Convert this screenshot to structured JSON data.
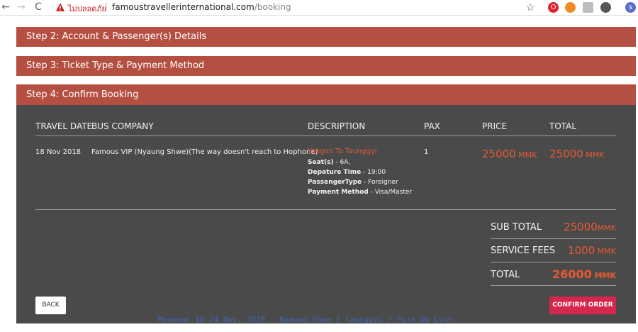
{
  "browser": {
    "back_icon": "←",
    "forward_icon": "→",
    "reload_icon": "C",
    "security_warning": "ไม่ปลอดภัย",
    "url_host": "famoustravellerinternational.com",
    "url_path": "/booking",
    "star_icon": "☆",
    "profile_initial": "s"
  },
  "steps": {
    "step2": "Step 2: Account & Passenger(s) Details",
    "step3": "Step 3: Ticket Type & Payment Method",
    "step4": "Step 4: Confirm Booking"
  },
  "table": {
    "headers": {
      "travel_date": "TRAVEL DATE",
      "bus_company": "BUS COMPANY",
      "description": "DESCRIPTION",
      "pax": "PAX",
      "price": "PRICE",
      "total": "TOTAL"
    },
    "row": {
      "travel_date": "18 Nov 2018",
      "bus_company": "Famous VIP (Nyaung Shwe)(The way doesn't reach to Hophone)",
      "route": "Yangon To Taunggyi",
      "seat_label": "Seat(s)",
      "seat_value": " - 6A,",
      "departure_label": "Depature Time",
      "departure_value": " - 19:00",
      "passenger_label": "PassengerType",
      "passenger_value": " - Foreigner",
      "payment_label": "Payment Method",
      "payment_value": " - Visa/Master",
      "pax": "1",
      "price": "25000",
      "price_currency": " MMK",
      "total": "25000",
      "total_currency": " MMK"
    }
  },
  "summary": {
    "subtotal_label": "SUB TOTAL",
    "subtotal_value": "25000",
    "subtotal_currency": "MMK",
    "fees_label": "SERVICE FEES",
    "fees_value": "1000",
    "fees_currency": " MMK",
    "total_label": "TOTAL",
    "total_value": "26000",
    "total_currency": " MMK"
  },
  "buttons": {
    "back": "BACK",
    "confirm": "CONFIRM ORDER"
  },
  "watermark": "Myanmar 18-24 Nov. 2018 - Nyaung Shwe / Taunggyi / Pyin Oo Lwin",
  "colors": {
    "step_header": "#b54f42",
    "panel": "#4a4a4a",
    "accent_price": "#e65a32",
    "confirm_button": "#d7264e"
  }
}
